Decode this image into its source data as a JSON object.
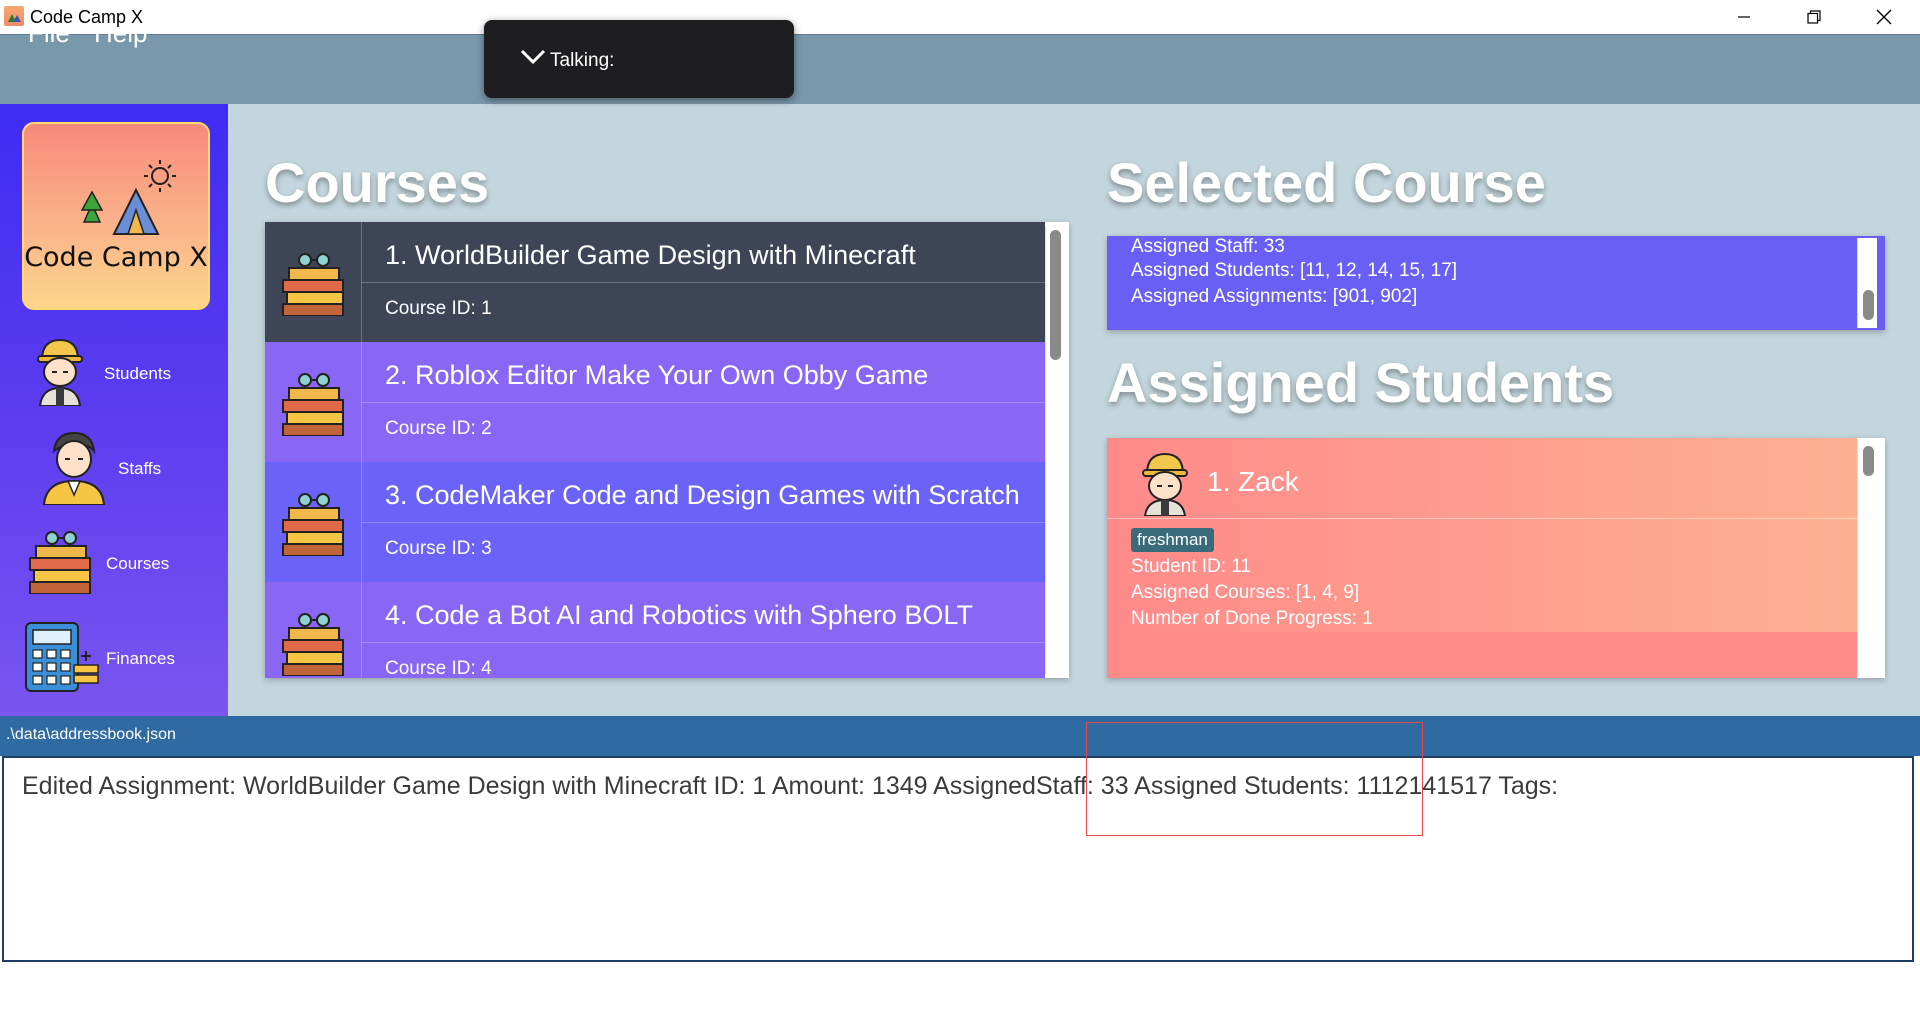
{
  "window": {
    "title": "Code Camp X",
    "controls": {
      "minimize_icon": "minimize-icon",
      "maximize_icon": "restore-icon",
      "close_icon": "close-icon"
    }
  },
  "menu": {
    "items": [
      "File",
      "Help"
    ]
  },
  "overlay": {
    "label": "Talking:",
    "icon": "chevron-down-icon"
  },
  "sidebar": {
    "logo_text": "Code Camp X",
    "items": [
      {
        "label": "Students",
        "icon": "student-avatar-icon"
      },
      {
        "label": "Staffs",
        "icon": "staff-avatar-icon"
      },
      {
        "label": "Courses",
        "icon": "books-icon"
      },
      {
        "label": "Finances",
        "icon": "calculator-icon"
      }
    ]
  },
  "courses": {
    "title": "Courses",
    "items": [
      {
        "name": "1. WorldBuilder Game Design with Minecraft",
        "id": "Course ID: 1",
        "color": "#3d4556",
        "selected": true
      },
      {
        "name": "2. Roblox Editor Make Your Own Obby Game",
        "id": "Course ID: 2",
        "color": "#8a66f5",
        "selected": false
      },
      {
        "name": "3. CodeMaker Code and Design Games with Scratch",
        "id": "Course ID: 3",
        "color": "#6b63f7",
        "selected": false
      },
      {
        "name": "4. Code a Bot AI and Robotics with Sphero BOLT",
        "id": "Course ID: 4",
        "color": "#8a66f5",
        "selected": false
      }
    ]
  },
  "selected_course": {
    "title": "Selected Course",
    "lines": [
      "Assigned Staff: 33",
      "Assigned Students: [11, 12, 14, 15, 17]",
      "Assigned Assignments: [901, 902]"
    ]
  },
  "assigned_students": {
    "title": "Assigned Students",
    "items": [
      {
        "name": "1.  Zack",
        "tag": "freshman",
        "lines": [
          "Student ID: 11",
          "Assigned Courses: [1, 4, 9]",
          "Number of Done Progress: 1"
        ]
      }
    ]
  },
  "status": {
    "path": ".\\data\\addressbook.json"
  },
  "result": {
    "text": "Edited Assignment: WorldBuilder Game Design with Minecraft ID: 1 Amount: 1349 AssignedStaff: 33 Assigned Students: 1112141517 Tags:"
  },
  "colors": {
    "menubar": "#7a98ab",
    "sidebar_top": "#3f2cf2",
    "content_bg": "#c3d6dd",
    "selected_course_bg": "#6a5ff5",
    "student_card": "#ff8a8a",
    "statusbar": "#2f6aa3"
  }
}
